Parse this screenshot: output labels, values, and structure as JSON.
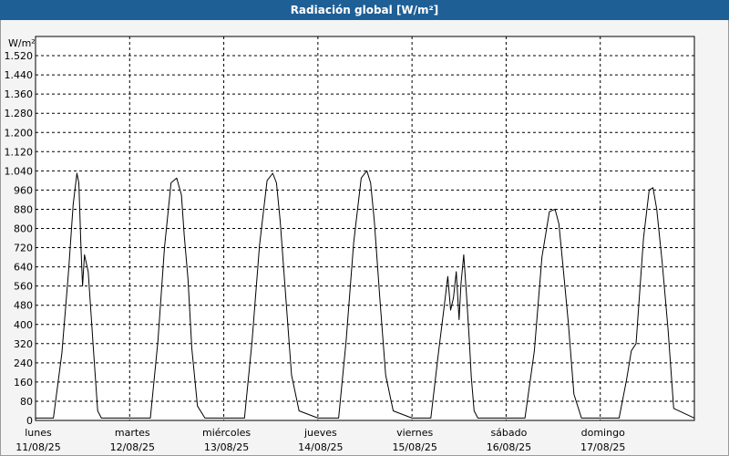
{
  "window": {
    "title": "Radiación global [W/m²]"
  },
  "chart_data": {
    "type": "line",
    "title": "Radiación global [W/m²]",
    "ylabel": "W/m²",
    "xlabel": "",
    "ylim": [
      0,
      1600
    ],
    "yticks": [
      0,
      80,
      160,
      240,
      320,
      400,
      480,
      560,
      640,
      720,
      800,
      880,
      960,
      1040,
      1120,
      1200,
      1280,
      1360,
      1440,
      1520
    ],
    "ytick_labels": [
      "0",
      "80",
      "160",
      "240",
      "320",
      "400",
      "480",
      "560",
      "640",
      "720",
      "800",
      "880",
      "960",
      "1.040",
      "1.120",
      "1.200",
      "1.280",
      "1.360",
      "1.440",
      "1.520"
    ],
    "xlim": [
      0,
      7
    ],
    "xticks": [
      {
        "day": "lunes",
        "date": "11/08/25",
        "x": 0
      },
      {
        "day": "martes",
        "date": "12/08/25",
        "x": 1
      },
      {
        "day": "miércoles",
        "date": "13/08/25",
        "x": 2
      },
      {
        "day": "jueves",
        "date": "14/08/25",
        "x": 3
      },
      {
        "day": "viernes",
        "date": "15/08/25",
        "x": 4
      },
      {
        "day": "sábado",
        "date": "16/08/25",
        "x": 5
      },
      {
        "day": "domingo",
        "date": "17/08/25",
        "x": 6
      }
    ],
    "grid": true,
    "series": [
      {
        "name": "",
        "x": [
          0,
          0.19,
          0.28,
          0.35,
          0.4,
          0.44,
          0.46,
          0.47,
          0.48,
          0.49,
          0.5,
          0.52,
          0.56,
          0.62,
          0.66,
          0.7,
          1,
          1.22,
          1.3,
          1.37,
          1.44,
          1.5,
          1.55,
          1.58,
          1.62,
          1.66,
          1.72,
          1.8,
          2,
          2.22,
          2.3,
          2.38,
          2.46,
          2.52,
          2.56,
          2.6,
          2.66,
          2.72,
          2.8,
          3,
          3.22,
          3.3,
          3.38,
          3.46,
          3.52,
          3.56,
          3.6,
          3.66,
          3.72,
          3.8,
          4,
          4.2,
          4.28,
          4.34,
          4.38,
          4.41,
          4.44,
          4.47,
          4.5,
          4.52,
          4.55,
          4.58,
          4.61,
          4.63,
          4.66,
          4.7,
          4.75,
          4.8,
          5,
          5.2,
          5.3,
          5.38,
          5.46,
          5.52,
          5.56,
          5.6,
          5.66,
          5.72,
          5.8,
          6,
          6.2,
          6.28,
          6.33,
          6.38,
          6.46,
          6.52,
          6.56,
          6.6,
          6.66,
          6.72,
          6.78,
          7
        ],
        "values": [
          10,
          10,
          280,
          620,
          900,
          1030,
          990,
          880,
          750,
          650,
          560,
          690,
          620,
          270,
          40,
          10,
          10,
          10,
          330,
          720,
          990,
          1010,
          940,
          770,
          590,
          300,
          60,
          10,
          10,
          10,
          330,
          730,
          1000,
          1030,
          990,
          830,
          510,
          190,
          40,
          10,
          10,
          330,
          740,
          1010,
          1040,
          990,
          830,
          500,
          190,
          40,
          10,
          10,
          280,
          470,
          600,
          460,
          510,
          620,
          420,
          570,
          690,
          520,
          330,
          180,
          40,
          10,
          10,
          10,
          10,
          10,
          290,
          680,
          870,
          880,
          820,
          660,
          410,
          110,
          10,
          10,
          10,
          170,
          290,
          320,
          760,
          960,
          970,
          880,
          650,
          380,
          50,
          10
        ]
      }
    ]
  }
}
